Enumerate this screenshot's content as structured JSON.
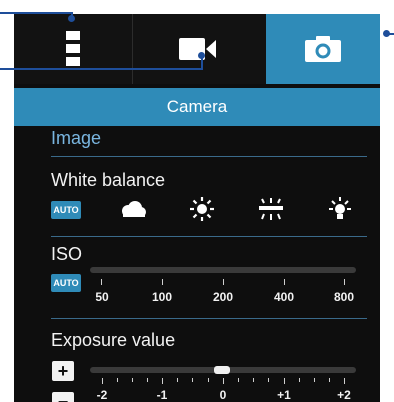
{
  "colors": {
    "accent": "#2f8bb8",
    "callout": "#1e4e9a",
    "section": "#7ab6e0"
  },
  "tabs": [
    {
      "name": "settings-menu",
      "icon": "vertical-menu-icon"
    },
    {
      "name": "video",
      "icon": "video-camera-icon"
    },
    {
      "name": "camera",
      "icon": "camera-icon",
      "selected": true
    }
  ],
  "header": {
    "title": "Camera"
  },
  "section": {
    "title": "Image"
  },
  "white_balance": {
    "label": "White balance",
    "auto_label": "AUTO",
    "options": [
      "auto",
      "cloudy",
      "daylight",
      "fluorescent",
      "incandescent"
    ],
    "selected": "auto"
  },
  "iso": {
    "label": "ISO",
    "auto_label": "AUTO",
    "values": [
      "50",
      "100",
      "200",
      "400",
      "800"
    ],
    "selected": "auto"
  },
  "exposure": {
    "label": "Exposure value",
    "plus_label": "+",
    "minus_label": "−",
    "scale_labels": [
      "-2",
      "-1",
      "0",
      "+1",
      "+2"
    ],
    "value": 0
  }
}
